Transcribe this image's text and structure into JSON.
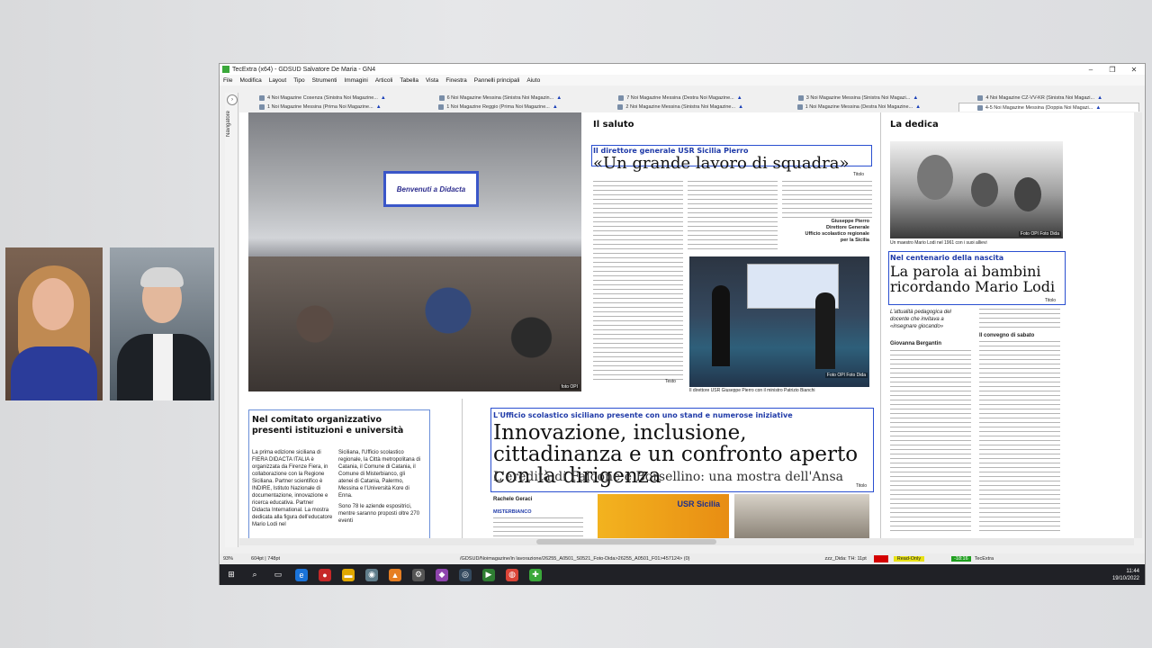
{
  "window": {
    "title": "TecExtra (x64) - GDSUD Salvatore De Maria - GN4",
    "controls": {
      "minimize": "–",
      "maximize": "❐",
      "close": "✕"
    }
  },
  "menu": [
    "File",
    "Modifica",
    "Layout",
    "Tipo",
    "Strumenti",
    "Immagini",
    "Articoli",
    "Tabella",
    "Vista",
    "Finestra",
    "Pannelli principali",
    "Aiuto"
  ],
  "tabs_row1": [
    "4 Noi Magazine Cosenza (Sinistra Noi Magazine...",
    "6 Noi Magazine Messina (Sinistra Noi Magazin...",
    "7 Noi Magazine Messina (Destra Noi Magazine...",
    "3 Noi Magazine Messina (Sinistra Noi Magazi...",
    "4 Noi Magazine CZ-VV-KR (Sinistra Noi Magazi..."
  ],
  "tabs_row2": [
    "1 Noi Magazine Messina (Prima Noi Magazine...",
    "1 Noi Magazine Reggio (Prima Noi Magazine...",
    "2 Noi Magazine Messina (Sinistra Noi Magazine...",
    "1 Noi Magazine Messina (Destra Noi Magazine...",
    "4-5 Noi Magazine Messina (Doppia Noi Magazi..."
  ],
  "navigator_label": "Navigatore",
  "page": {
    "banner_text": "Benvenuti a Didacta",
    "photo_credit_main": "foto OPI",
    "saluto": {
      "section": "Il saluto",
      "kicker": "Il direttore generale USR Sicilia Pierro",
      "headline": "«Un grande lavoro di squadra»",
      "titolo_tag": "Titolo",
      "signature_name": "Giuseppe Pierro",
      "signature_role": "Direttore Generale",
      "signature_office": "Ufficio scolastico regionale per la Sicilia",
      "testo_tag": "Testo"
    },
    "photo2_caption": "Il direttore USR Giuseppe Pierro con il ministro Patrizio Bianchi",
    "photo2_credit": "Foto OPI Foto Dida",
    "dedica": {
      "section": "La dedica",
      "photo_caption": "Un maestro Mario Lodi nel 1961 con i suoi allievi",
      "photo_credit": "Foto OPI Foto Dida",
      "kicker": "Nel centenario della nascita",
      "headline": "La parola ai bambini ricordando Mario Lodi",
      "titolo_tag": "Titolo",
      "subhead": "L'attualità pedagogica del docente che invitava a «insegnare giocando»",
      "author": "Giovanna Bergantin",
      "subsection": "Il convegno di sabato"
    },
    "comitato": {
      "heading": "Nel comitato organizzativo presenti istituzioni e università",
      "body_start": "La prima edizione siciliana di FIERA DIDACTA ITALIA è organizzata da Firenze Fiera, in collaborazione con la Regione Siciliana. Partner scientifico è INDIRE, Istituto Nazionale di documentazione, innovazione e ricerca educativa. Partner Didacta International. La mostra dedicata alla figura dell'educatore Mario Lodi nel",
      "body_col2": "Siciliana, l'Ufficio scolastico regionale, la Città metropolitana di Catania, il Comune di Catania, il Comune di Misterbianco, gli atenei di Catania, Palermo, Messina e l'Università Kore di Enna.",
      "body_col2b": "Sono 78 le aziende espositrici, mentre saranno proposti oltre 270 eventi"
    },
    "innovazione": {
      "kicker": "L'Ufficio scolastico siciliano presente con uno stand e numerose iniziative",
      "headline": "Innovazione, inclusione, cittadinanza e un confronto aperto con la dirigenza",
      "subhead": "L'eredità di Falcone e Borsellino: una mostra dell'Ansa",
      "titolo_tag": "Titolo",
      "author": "Rachele Geraci",
      "dateline": "MISTERBIANCO",
      "photo4_text": "USR Sicilia"
    }
  },
  "status": {
    "zoom": "93%",
    "coords": "604pt | 748pt",
    "path": "/GDSUD/Noimagazine/in lavorazione/26255_A0501_S0521_Foto-Dida>26255_A0501_F01>457124> (0)",
    "style": "zzz_Dida: TH: 11pt",
    "readonly": "Read-Only",
    "counter": "-18:16",
    "app": "TecExtra"
  },
  "taskbar": {
    "time": "11:44",
    "date": "19/10/2022"
  },
  "colors": {
    "accent": "#1f3aa8",
    "readonly": "#e8e214",
    "taskbar": "#202126"
  }
}
